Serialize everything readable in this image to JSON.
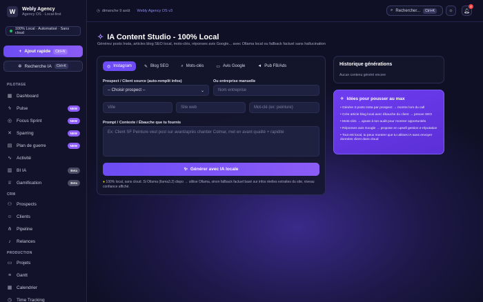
{
  "brand": {
    "name": "Webly Agency",
    "sub": "Agency OS · Local-first",
    "logo": "W"
  },
  "status_pill": "100% Local · Automatisé · Sans cloud",
  "quick_add": {
    "label": "Ajout rapide",
    "kbd": "Ctrl+N"
  },
  "ai_search": {
    "label": "Recherche IA",
    "kbd": "Ctrl+K"
  },
  "sections": {
    "pilotage": "PILOTAGE",
    "crm": "CRM",
    "production": "PRODUCTION"
  },
  "nav_pilotage": [
    {
      "label": "Dashboard",
      "icon": "grid-icon",
      "badge": ""
    },
    {
      "label": "Pulse",
      "icon": "zap-icon",
      "badge": "NEW"
    },
    {
      "label": "Focus Sprint",
      "icon": "target-icon",
      "badge": "NEW"
    },
    {
      "label": "Sparring",
      "icon": "swords-icon",
      "badge": "NEW"
    },
    {
      "label": "Plan de guerre",
      "icon": "map-icon",
      "badge": "NEW"
    },
    {
      "label": "Activité",
      "icon": "activity-icon",
      "badge": ""
    },
    {
      "label": "BI IA",
      "icon": "chart-icon",
      "badge": "Beta"
    },
    {
      "label": "Gamification",
      "icon": "trophy-icon",
      "badge": "Beta"
    }
  ],
  "nav_crm": [
    {
      "label": "Prospects",
      "icon": "users-icon"
    },
    {
      "label": "Clients",
      "icon": "user-check-icon"
    },
    {
      "label": "Pipeline",
      "icon": "pipeline-icon"
    },
    {
      "label": "Relances",
      "icon": "bell-icon"
    }
  ],
  "nav_production": [
    {
      "label": "Projets",
      "icon": "folder-icon"
    },
    {
      "label": "Gantt",
      "icon": "gantt-icon"
    },
    {
      "label": "Calendrier",
      "icon": "calendar-icon"
    },
    {
      "label": "Time Tracking",
      "icon": "clock-icon"
    }
  ],
  "topbar": {
    "date": "dimanche 9 août",
    "os": "Webly Agency OS v3",
    "search": "Rechercher...",
    "search_kbd": "Ctrl+K",
    "notif_count": "4"
  },
  "page": {
    "title": "IA Content Studio - 100% Local",
    "subtitle": "Générez posts Insta, articles blog SEO local, mots-clés, réponses avis Google... avec Ollama local ou fallback factuel sans hallucination"
  },
  "tabs": [
    "Instagram",
    "Blog SEO",
    "Mots-clés",
    "Avis Google",
    "Pub FB/Ads"
  ],
  "form": {
    "prospect_label": "Prospect / Client source (auto-remplit infos)",
    "prospect_value": "-- Choisir prospect --",
    "company_label": "Ou entreprise manuelle",
    "company_placeholder": "Nom entreprise",
    "city_placeholder": "Ville",
    "site_placeholder": "Site web",
    "keyword_placeholder": "Mot-clé (ex: peinture)",
    "prompt_label": "Prompt / Contexte / Ébauche que tu fournis",
    "prompt_placeholder": "Ex: Client SF Peinture veut post sur avant/après chantier Colmar, met en avant qualité + rapidité",
    "generate_label": "Générer avec IA locale",
    "note": "100% local, sans cloud. Si Ollama (llama3.2) dispo → utilise Ollama, sinon fallback factuel basé sur infos réelles extraites du site, niveau confiance affiché."
  },
  "history": {
    "title": "Historique générations",
    "empty": "Aucun contenu généré encore"
  },
  "ideas": {
    "title": "Idées pour pousser au max",
    "items": [
      "• Génère 3 posts Insta par prospect → montre lors du call",
      "• Crée article blog local avec ébauche du client → preuve SEO",
      "• Mots-clés → ajoute à ton audit pour montrer opportunités",
      "• Réponses avis Google → propose en upsell gestion e-réputation",
      "• Tout est local, tu peux montrer que tu utilises IA sans envoyer données client dans cloud"
    ]
  },
  "colors": {
    "accent": "#6d4cf5",
    "accent2": "#8b5cf6",
    "bg": "#0e0f22",
    "sidebar": "#12132a",
    "success": "#22c55e",
    "danger": "#ef4444"
  }
}
